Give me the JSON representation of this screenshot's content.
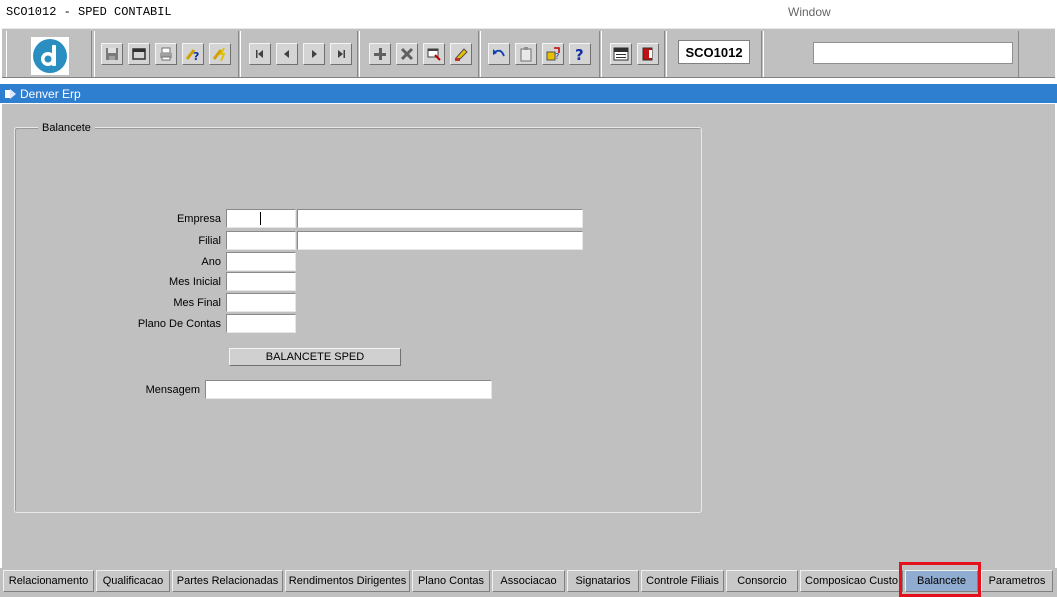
{
  "window": {
    "title": "SCO1012 - SPED CONTABIL",
    "menu_label": "Window"
  },
  "toolbar": {
    "logo_icon": "denver-logo-icon",
    "buttons": [
      {
        "name": "save-icon"
      },
      {
        "name": "window-icon"
      },
      {
        "name": "print-icon"
      },
      {
        "name": "query-help-icon"
      },
      {
        "name": "execute-query-icon"
      },
      {
        "name": "first-record-icon"
      },
      {
        "name": "previous-record-icon"
      },
      {
        "name": "next-record-icon"
      },
      {
        "name": "last-record-icon"
      },
      {
        "name": "insert-record-icon"
      },
      {
        "name": "delete-record-icon"
      },
      {
        "name": "duplicate-record-icon"
      },
      {
        "name": "clear-record-icon"
      },
      {
        "name": "undo-icon"
      },
      {
        "name": "clipboard-icon"
      },
      {
        "name": "list-values-icon"
      },
      {
        "name": "help-icon"
      },
      {
        "name": "menu-icon"
      },
      {
        "name": "exit-icon"
      }
    ],
    "form_code": "SCO1012",
    "field_value": ""
  },
  "header_bar": {
    "title": "Denver Erp"
  },
  "form": {
    "frame_title": "Balancete",
    "fields": {
      "empresa": {
        "label": "Empresa",
        "code": "",
        "description": ""
      },
      "filial": {
        "label": "Filial",
        "code": "",
        "description": ""
      },
      "ano": {
        "label": "Ano",
        "value": ""
      },
      "mes_inicial": {
        "label": "Mes Inicial",
        "value": ""
      },
      "mes_final": {
        "label": "Mes Final",
        "value": ""
      },
      "plano_de_contas": {
        "label": "Plano De Contas",
        "value": ""
      }
    },
    "button_label": "BALANCETE SPED",
    "mensagem": {
      "label": "Mensagem",
      "value": ""
    }
  },
  "tabs": [
    {
      "label": "Relacionamento",
      "active": false
    },
    {
      "label": "Qualificacao",
      "active": false
    },
    {
      "label": "Partes Relacionadas",
      "active": false
    },
    {
      "label": "Rendimentos Dirigentes",
      "active": false
    },
    {
      "label": "Plano Contas",
      "active": false
    },
    {
      "label": "Associacao",
      "active": false
    },
    {
      "label": "Signatarios",
      "active": false
    },
    {
      "label": "Controle Filiais",
      "active": false
    },
    {
      "label": "Consorcio",
      "active": false
    },
    {
      "label": "Composicao Custo",
      "active": false
    },
    {
      "label": "Balancete",
      "active": true
    },
    {
      "label": "Parametros",
      "active": false
    }
  ],
  "colors": {
    "header_bar": "#2f7fd1",
    "workspace": "#c0c0c0",
    "active_tab": "#90acd0",
    "highlight": "#e4101c"
  }
}
